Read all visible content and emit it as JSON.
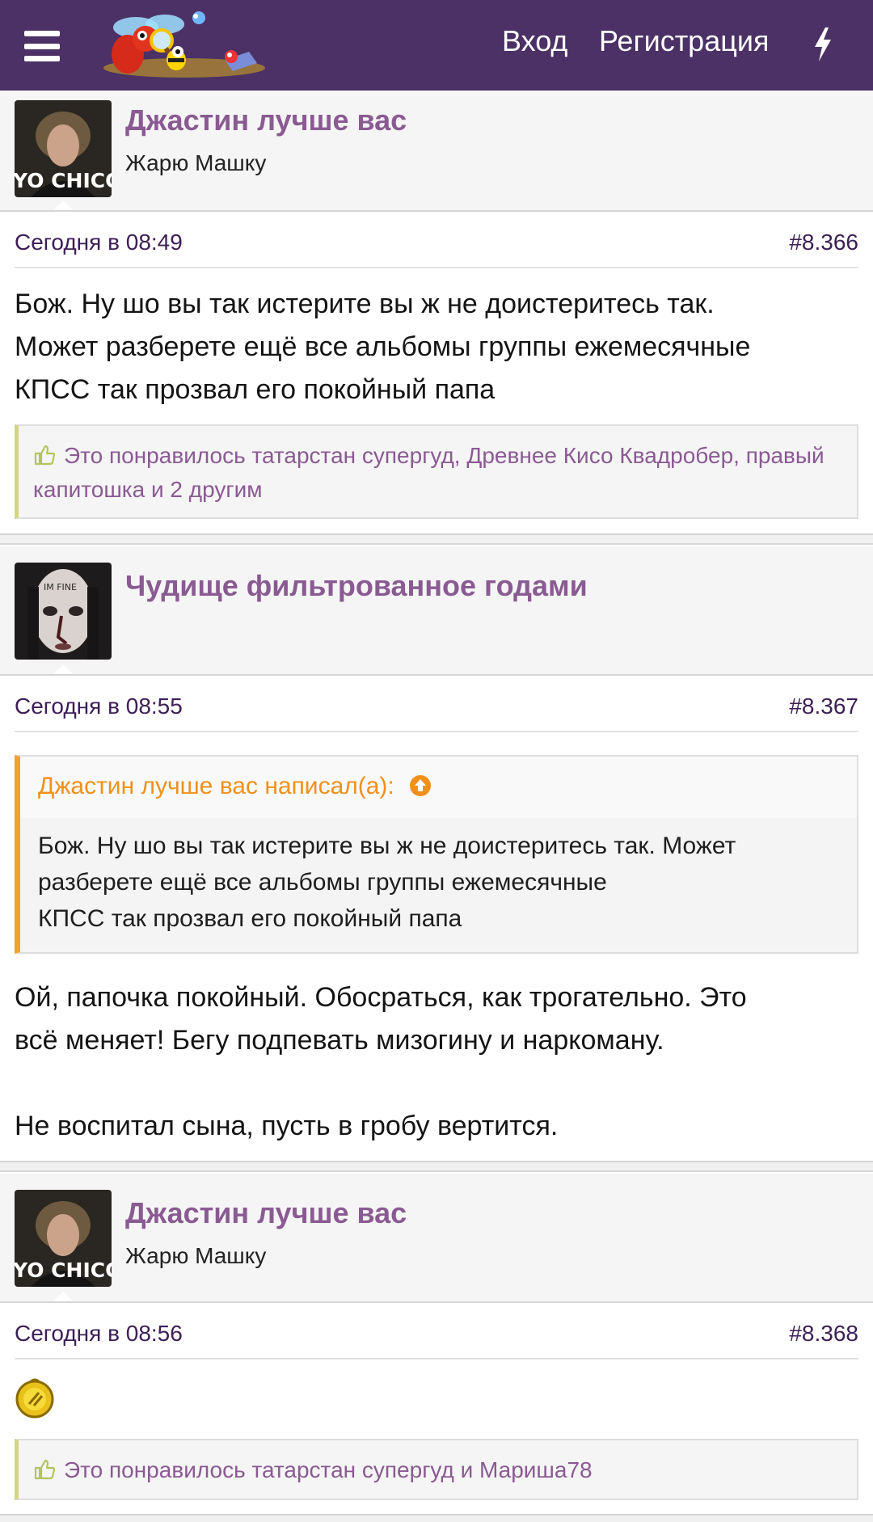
{
  "header": {
    "login": "Вход",
    "register": "Регистрация",
    "logo_icon": "bee-logo",
    "bolt_icon": "lightning-icon",
    "background": "#4b3165"
  },
  "posts": [
    {
      "author": "Джастин лучше вас",
      "user_title": "Жарю Машку",
      "avatar_caption": "YO CHICO",
      "date": "Сегодня в 08:49",
      "number": "#8.366",
      "lines": [
        "Бож. Ну шо вы так истерите вы ж не доистеритесь так.",
        "Может разберете ещё все альбомы группы ежемесячные",
        "КПСС так прозвал его покойный папа"
      ],
      "likes": {
        "prefix": "Это понравилось",
        "names": "татарстан супергуд, Древнее Кисо Квадробер, правый капитошка и 2 другим"
      }
    },
    {
      "author": "Чудище фильтрованное годами",
      "avatar_caption": "IM FINE",
      "date": "Сегодня в 08:55",
      "number": "#8.367",
      "quote": {
        "header": "Джастин лучше вас написал(а):",
        "lines": [
          "Бож. Ну шо вы так истерите вы ж не доистеритесь так. Может",
          "разберете ещё все альбомы группы ежемесячные",
          "КПСС так прозвал его покойный папа"
        ]
      },
      "lines": [
        "Ой, папочка покойный. Обосраться, как трогательно. Это",
        "всё меняет! Бегу подпевать мизогину и наркоману.",
        "",
        "Не воспитал сына, пусть в гробу вертится."
      ]
    },
    {
      "author": "Джастин лучше вас",
      "user_title": "Жарю Машку",
      "avatar_caption": "YO CHICO",
      "date": "Сегодня в 08:56",
      "number": "#8.368",
      "smiley_icon": "gold-smiley-icon",
      "likes": {
        "prefix": "Это понравилось",
        "names": "татарстан супергуд и Мариша78"
      }
    }
  ]
}
